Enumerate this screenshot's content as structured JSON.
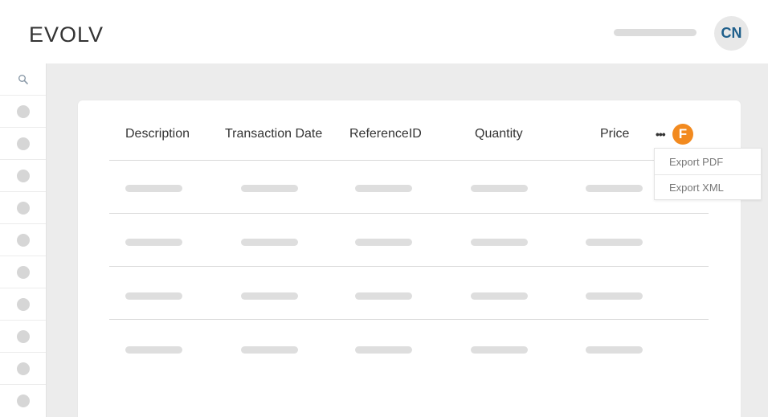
{
  "header": {
    "logo": "EVOLV",
    "avatar_initials": "CN"
  },
  "sidebar": {
    "search_icon": "search-icon",
    "item_count": 10
  },
  "table": {
    "columns": [
      "Description",
      "Transaction Date",
      "ReferenceID",
      "Quantity",
      "Price"
    ],
    "rows_loading": 4
  },
  "actions": {
    "more_icon": "more-horizontal-icon",
    "badge_letter": "F",
    "badge_color": "#f28a1f"
  },
  "export_menu": {
    "items": [
      "Export PDF",
      "Export XML"
    ]
  },
  "colors": {
    "background": "#ececec",
    "avatar_text": "#1f5f8b",
    "accent": "#f28a1f"
  }
}
